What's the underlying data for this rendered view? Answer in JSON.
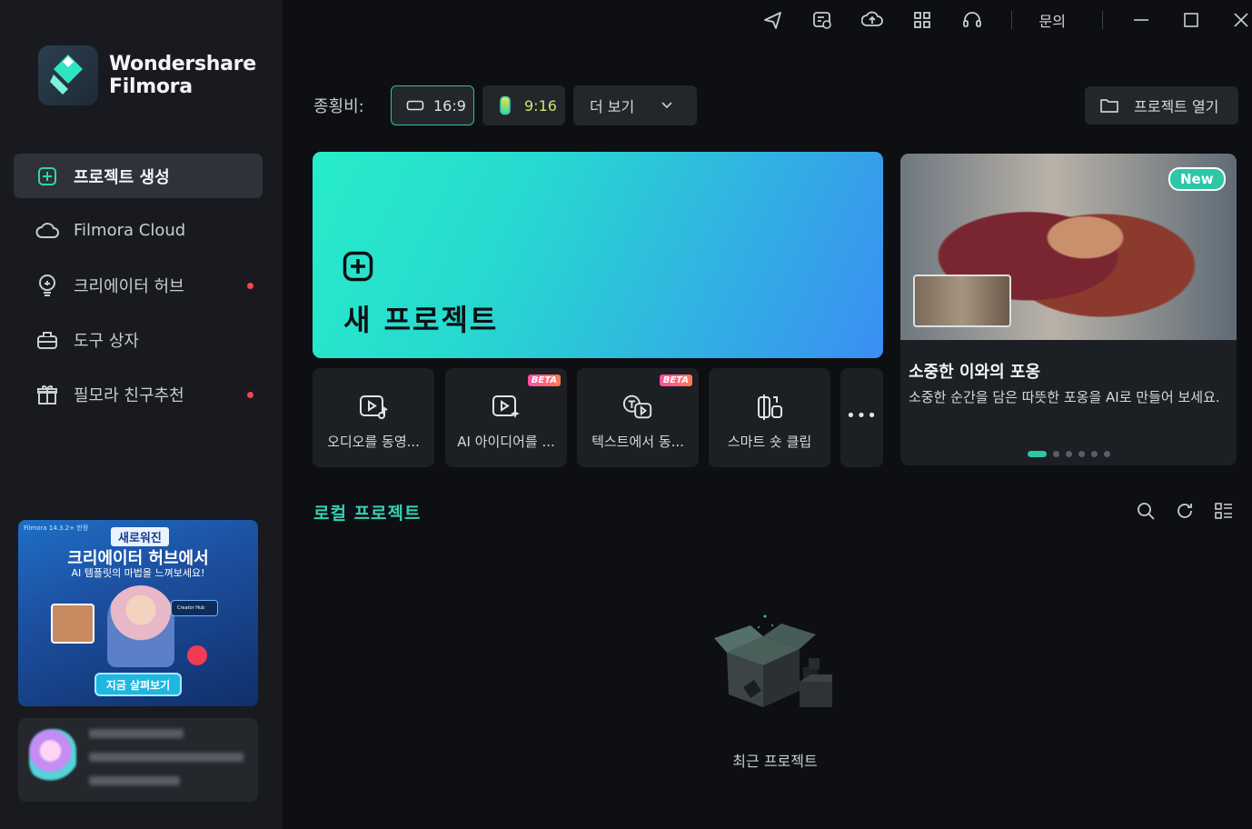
{
  "app": {
    "brand_line1": "Wondershare",
    "brand_line2": "Filmora"
  },
  "sidebar": {
    "items": [
      {
        "label": "프로젝트 생성",
        "icon": "plus-square-icon",
        "active": true,
        "badge": false
      },
      {
        "label": "Filmora Cloud",
        "icon": "cloud-icon",
        "active": false,
        "badge": false
      },
      {
        "label": "크리에이터 허브",
        "icon": "bulb-icon",
        "active": false,
        "badge": true
      },
      {
        "label": "도구 상자",
        "icon": "toolbox-icon",
        "active": false,
        "badge": false
      },
      {
        "label": "필모라 친구추천",
        "icon": "gift-icon",
        "active": false,
        "badge": true
      }
    ],
    "banner": {
      "version": "Filmora 14.3.2+ 한정",
      "tag": "새로워진",
      "headline": "크리에이터 허브에서",
      "subline": "AI 템플릿의 마법을 느껴보세요!",
      "card_label": "Creator Hub",
      "cta": "지금 살펴보기"
    }
  },
  "titlebar": {
    "icons": [
      "send-icon",
      "schedule-icon",
      "cloud-upload-icon",
      "apps-grid-icon",
      "headset-icon"
    ],
    "inquiry": "문의",
    "window_controls": [
      "minimize-icon",
      "maximize-icon",
      "close-icon"
    ]
  },
  "toolbar": {
    "ratio_label": "종횡비:",
    "ratio_169": "16:9",
    "ratio_916": "9:16",
    "more": "더 보기",
    "open_project": "프로젝트 열기",
    "selected_ratio": "16:9"
  },
  "new_project": {
    "label": "새 프로젝트"
  },
  "quick_tiles": [
    {
      "label": "오디오를 동영...",
      "icon": "audio-to-video-icon",
      "beta": ""
    },
    {
      "label": "AI 아이디어를 ...",
      "icon": "ai-idea-icon",
      "beta": "BETA"
    },
    {
      "label": "텍스트에서 동...",
      "icon": "text-to-video-icon",
      "beta": "BETA"
    },
    {
      "label": "스마트 숏 클립",
      "icon": "smart-short-clip-icon",
      "beta": ""
    }
  ],
  "promo": {
    "badge": "New",
    "title": "소중한 이와의 포옹",
    "description": "소중한 순간을 담은 따뜻한 포옹을 AI로 만들어 보세요.",
    "carousel_index": 1,
    "carousel_count": 6
  },
  "local": {
    "title": "로컬 프로젝트",
    "tools": [
      "search-icon",
      "refresh-icon",
      "list-view-icon"
    ],
    "empty_label": "최근 프로젝트"
  },
  "colors": {
    "accent": "#27c4a6",
    "badge_red": "#f5454d",
    "background": "#0d0f12",
    "sidebar": "#181a1f"
  }
}
